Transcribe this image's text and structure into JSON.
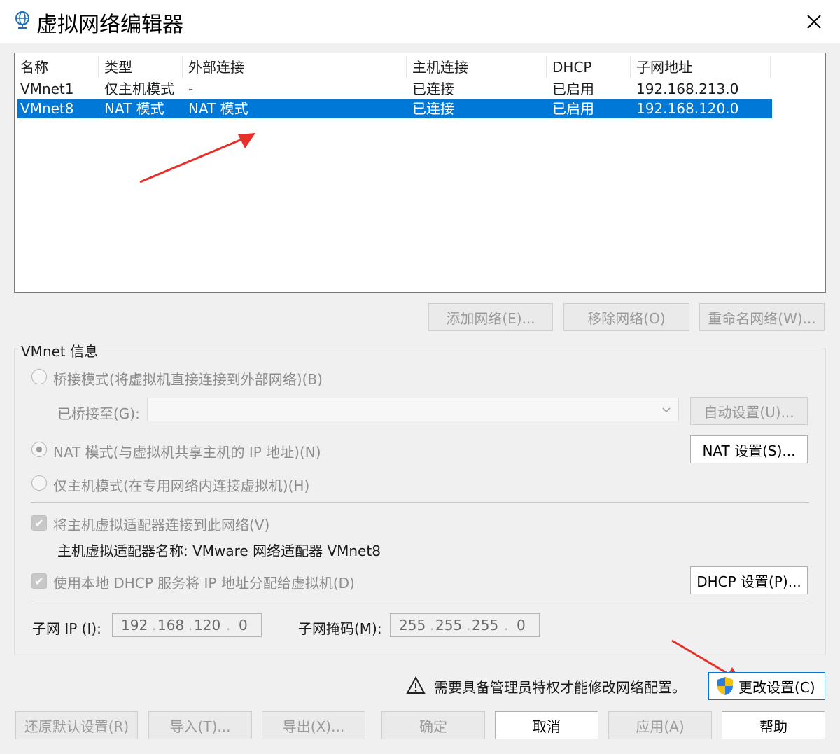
{
  "window": {
    "title": "虚拟网络编辑器"
  },
  "columns": [
    "名称",
    "类型",
    "外部连接",
    "主机连接",
    "DHCP",
    "子网地址"
  ],
  "networks": [
    {
      "name": "VMnet1",
      "type": "仅主机模式",
      "external": "-",
      "host": "已连接",
      "dhcp": "已启用",
      "subnet": "192.168.213.0",
      "selected": false
    },
    {
      "name": "VMnet8",
      "type": "NAT 模式",
      "external": "NAT 模式",
      "host": "已连接",
      "dhcp": "已启用",
      "subnet": "192.168.120.0",
      "selected": true
    }
  ],
  "list_buttons": {
    "add": "添加网络(E)...",
    "remove": "移除网络(O)",
    "rename": "重命名网络(W)..."
  },
  "info": {
    "group_label": "VMnet 信息",
    "bridge_label": "桥接模式(将虚拟机直接连接到外部网络)(B)",
    "bridged_to_label": "已桥接至(G):",
    "auto_btn": "自动设置(U)...",
    "nat_label": "NAT 模式(与虚拟机共享主机的 IP 地址)(N)",
    "nat_btn": "NAT 设置(S)...",
    "hostonly_label": "仅主机模式(在专用网络内连接虚拟机)(H)",
    "connect_adapter_label": "将主机虚拟适配器连接到此网络(V)",
    "adapter_name_label": "主机虚拟适配器名称: VMware 网络适配器 VMnet8",
    "dhcp_label": "使用本地 DHCP 服务将 IP 地址分配给虚拟机(D)",
    "dhcp_btn": "DHCP 设置(P)...",
    "subnet_ip_label": "子网 IP (I):",
    "subnet_ip": [
      "192",
      "168",
      "120",
      "0"
    ],
    "subnet_mask_label": "子网掩码(M):",
    "subnet_mask": [
      "255",
      "255",
      "255",
      "0"
    ]
  },
  "admin": {
    "warning": "需要具备管理员特权才能修改网络配置。",
    "change_btn": "更改设置(C)"
  },
  "footer": {
    "restore": "还原默认设置(R)",
    "import": "导入(T)...",
    "export": "导出(X)...",
    "ok": "确定",
    "cancel": "取消",
    "apply": "应用(A)",
    "help": "帮助"
  },
  "colors": {
    "selection": "#0078d7",
    "annotation_arrow": "#e8302a"
  }
}
